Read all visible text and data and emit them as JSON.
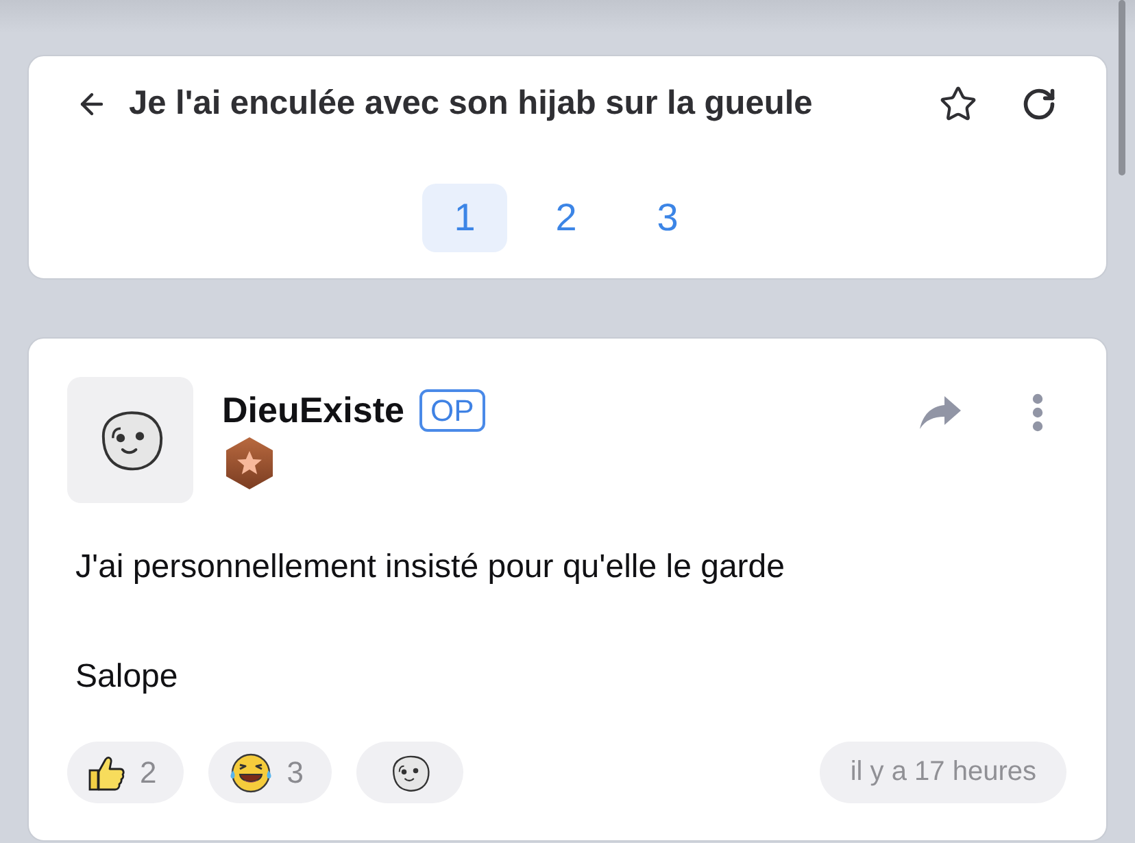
{
  "thread": {
    "title": "Je l'ai enculée avec son hijab sur la gueule",
    "pages": [
      {
        "label": "1",
        "selected": true
      },
      {
        "label": "2",
        "selected": false
      },
      {
        "label": "3",
        "selected": false
      }
    ]
  },
  "post": {
    "author": "DieuExiste",
    "author_badge": "OP",
    "body": [
      "J'ai personnellement insisté pour qu'elle le garde",
      "Salope"
    ],
    "reactions": [
      {
        "kind": "like",
        "count": "2"
      },
      {
        "kind": "laugh",
        "count": "3"
      }
    ],
    "time": "il y a 17 heures"
  }
}
